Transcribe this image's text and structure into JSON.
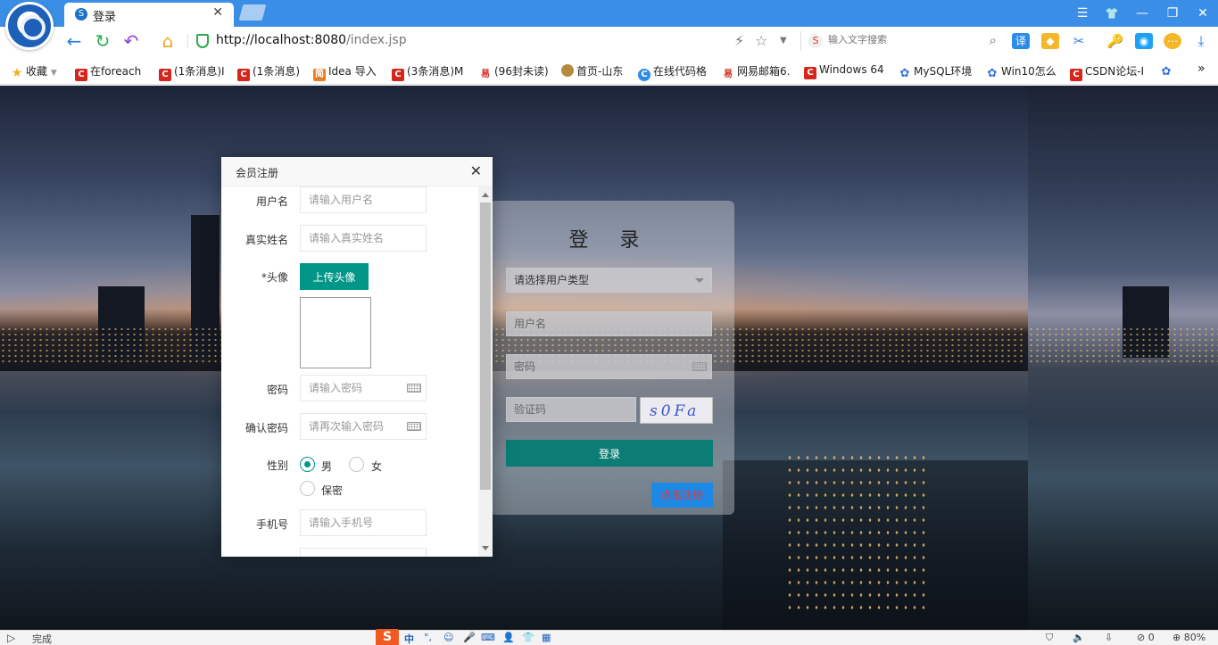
{
  "browser": {
    "tab_title": "登录",
    "tab_icon": "S",
    "url_host": "http://localhost:8080",
    "url_path": "/index.jsp",
    "search_placeholder": "输入文字搜索",
    "search_icon_letter": "S",
    "close_glyph": "✕",
    "window_controls": [
      "☰",
      "👕",
      "—",
      "❐",
      "✕"
    ]
  },
  "bookmarks": [
    {
      "label": "收藏",
      "icon": "star-icon"
    },
    {
      "label": "在foreach",
      "icon": "csdn-icon"
    },
    {
      "label": "(1条消息)I",
      "icon": "csdn-icon"
    },
    {
      "label": "(1条消息)",
      "icon": "csdn-icon"
    },
    {
      "label": "Idea 导入",
      "icon": "jianshu-icon"
    },
    {
      "label": "(3条消息)M",
      "icon": "csdn-icon"
    },
    {
      "label": "(96封未读)",
      "icon": "netease-icon"
    },
    {
      "label": "首页-山东",
      "icon": "site-icon"
    },
    {
      "label": "在线代码格",
      "icon": "ce-icon"
    },
    {
      "label": "网易邮箱6.",
      "icon": "netease-icon"
    },
    {
      "label": "Windows 64",
      "icon": "csdn-icon"
    },
    {
      "label": "MySQL环境",
      "icon": "baidu-paw-icon"
    },
    {
      "label": "Win10怎么",
      "icon": "baidu-paw-icon"
    },
    {
      "label": "CSDN论坛-I",
      "icon": "csdn-icon"
    }
  ],
  "login": {
    "title": "登 录",
    "user_type_placeholder": "请选择用户类型",
    "username_placeholder": "用户名",
    "password_placeholder": "密码",
    "captcha_placeholder": "验证码",
    "captcha_text": "s0Fa",
    "submit_label": "登录",
    "register_link": "点击注册"
  },
  "register_dialog": {
    "title": "会员注册",
    "fields": {
      "username_label": "用户名",
      "username_placeholder": "请输入用户名",
      "realname_label": "真实姓名",
      "realname_placeholder": "请输入真实姓名",
      "avatar_label": "*头像",
      "upload_label": "上传头像",
      "password_label": "密码",
      "password_placeholder": "请输入密码",
      "confirm_label": "确认密码",
      "confirm_placeholder": "请再次输入密码",
      "gender_label": "性别",
      "gender_options": [
        "男",
        "女",
        "保密"
      ],
      "gender_selected": "男",
      "phone_label": "手机号",
      "phone_placeholder": "请输入手机号"
    }
  },
  "statusbar": {
    "status_text": "完成",
    "ime_logo": "S",
    "ime_lang": "中",
    "ime_punct": "°,",
    "counter": "0",
    "zoom": "80%"
  }
}
